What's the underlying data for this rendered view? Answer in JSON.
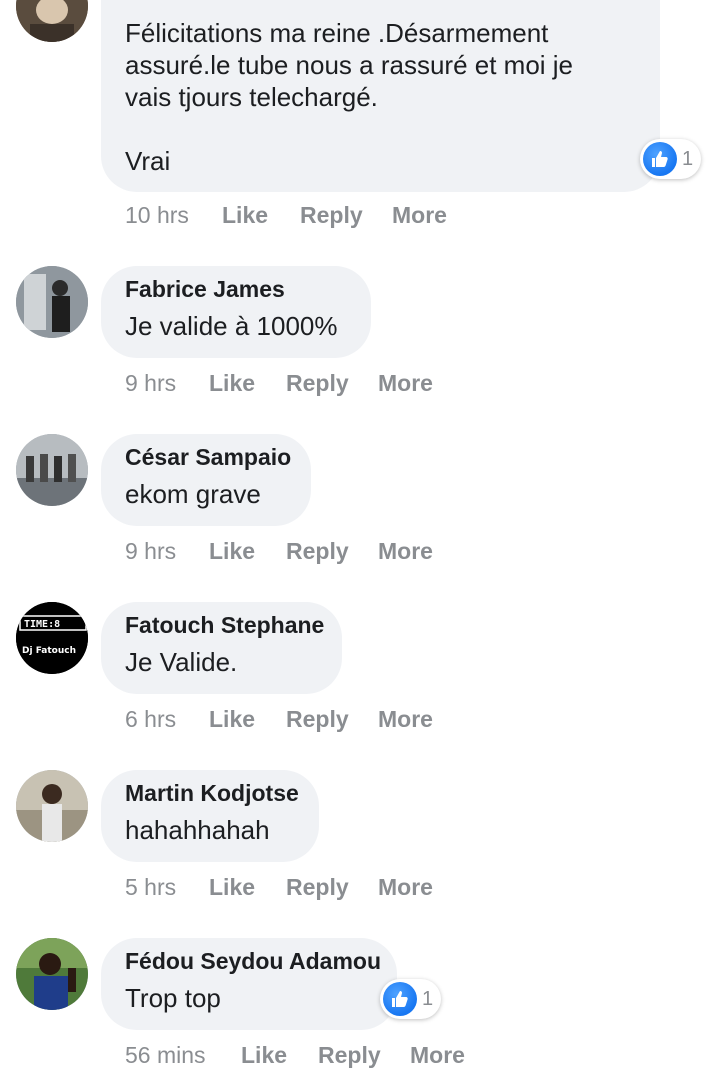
{
  "first_comment": {
    "lines": [
      "Félicitations ma reine .Désarmement",
      "assuré.le tube nous a rassuré et moi je",
      "vais tjours telechargé.",
      "Vrai"
    ],
    "reaction_count": "1",
    "time": "10 hrs"
  },
  "actions": {
    "like": "Like",
    "reply": "Reply",
    "more": "More"
  },
  "comments": [
    {
      "name": "Fabrice James",
      "text": "Je valide à 1000%",
      "time": "9 hrs"
    },
    {
      "name": "César Sampaio",
      "text": "ekom grave",
      "time": "9 hrs"
    },
    {
      "name": "Fatouch Stephane",
      "text": "Je Valide.",
      "time": "6 hrs",
      "avatar_text": [
        "TIME:8",
        "Dj Fatouch"
      ]
    },
    {
      "name": "Martin Kodjotse",
      "text": "hahahhahah",
      "time": "5 hrs"
    },
    {
      "name": "Fédou Seydou Adamou",
      "text": "Trop top",
      "time": "56 mins",
      "reaction_count": "1"
    }
  ],
  "colors": {
    "bubble": "#f0f2f5",
    "action_text": "#8a8d91",
    "like_blue": "#1877f2"
  },
  "icons": {
    "reaction": "thumbs-up-icon"
  }
}
